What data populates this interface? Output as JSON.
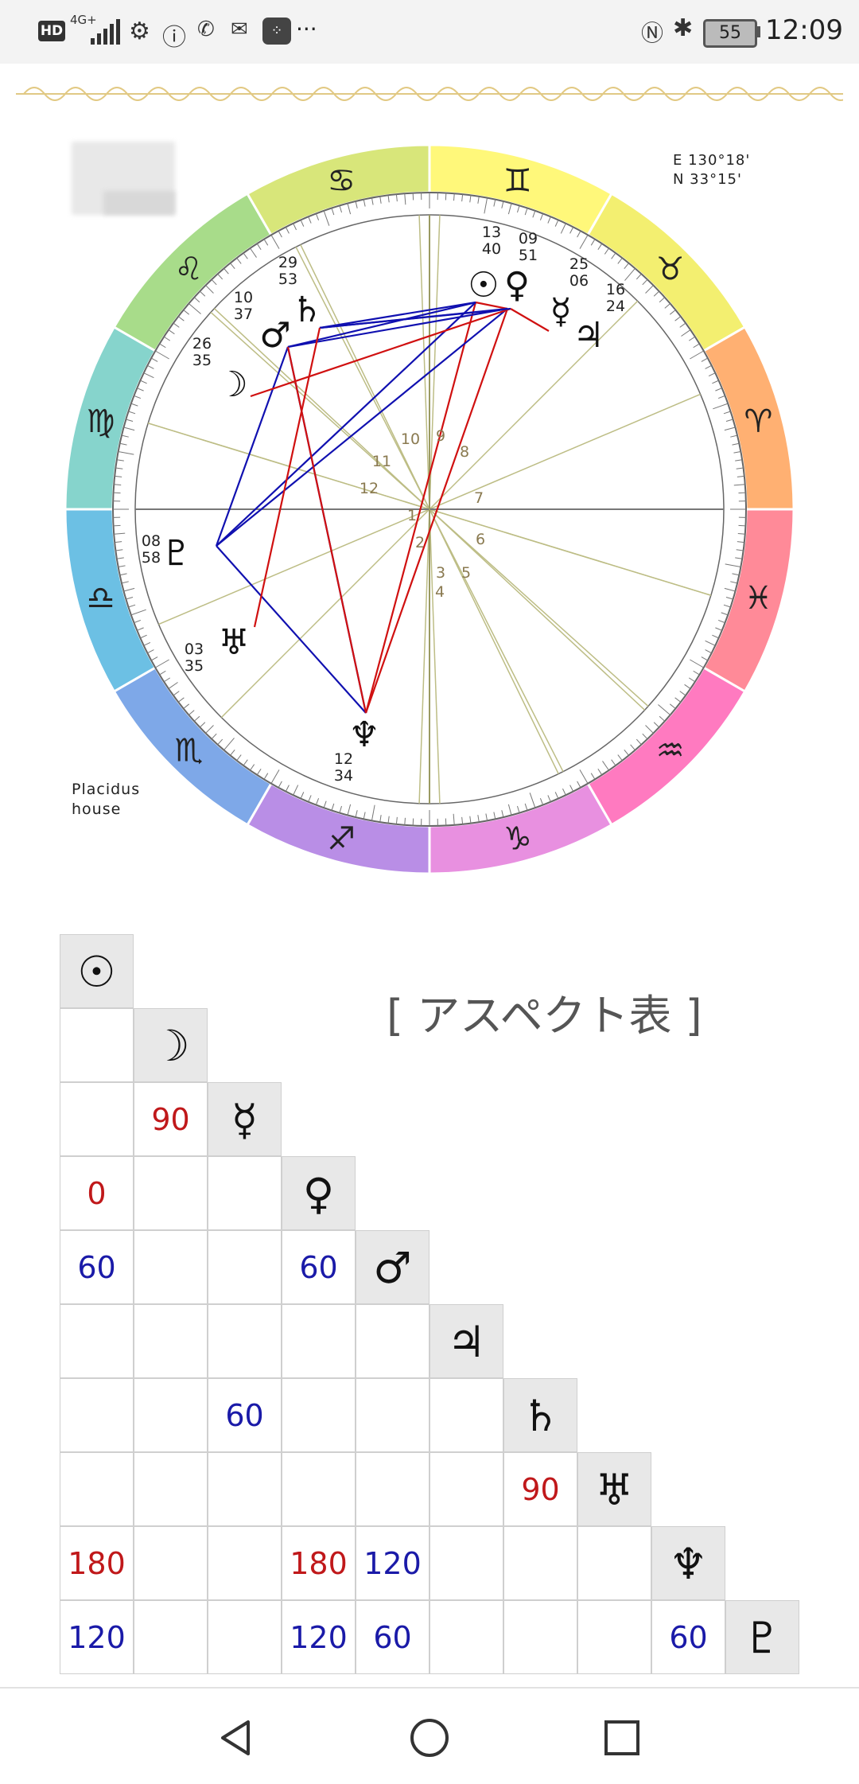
{
  "status_bar": {
    "hd": "HD",
    "network": "4G+",
    "battery": "55",
    "time": "12:09",
    "more": "···"
  },
  "chart": {
    "coords": [
      "E 130°18'",
      "N 33°15'"
    ],
    "house_system": [
      "Placidus",
      "house"
    ],
    "house_numbers": [
      "1",
      "2",
      "3",
      "4",
      "5",
      "6",
      "7",
      "8",
      "9",
      "10",
      "11",
      "12"
    ],
    "degree_labels": [
      [
        "13",
        "40"
      ],
      [
        "09",
        "51"
      ],
      [
        "25",
        "06"
      ],
      [
        "16",
        "24"
      ],
      [
        "29",
        "53"
      ],
      [
        "10",
        "37"
      ],
      [
        "26",
        "35"
      ],
      [
        "08",
        "58"
      ],
      [
        "03",
        "35"
      ],
      [
        "12",
        "34"
      ]
    ],
    "planets": [
      "☉",
      "♀",
      "☿",
      "♃",
      "♄",
      "♂",
      "☽",
      "♇",
      "♅",
      "♆"
    ],
    "signs": [
      "♊",
      "♉",
      "♈",
      "♓",
      "♒",
      "♑",
      "♐",
      "♏",
      "♎",
      "♍",
      "♌",
      "♋"
    ],
    "colors": {
      "red_aspect": "#d01010",
      "blue_aspect": "#1010b0",
      "house_line": "#bdbd85",
      "axis_line": "#777777"
    }
  },
  "aspect_table": {
    "title": "[ アスペクト表 ]",
    "planets": [
      "☉",
      "☽",
      "☿",
      "♀",
      "♂",
      "♃",
      "♄",
      "♅",
      "♆",
      "♇"
    ],
    "rows": [
      [],
      [
        ""
      ],
      [
        "",
        "90"
      ],
      [
        "0",
        "",
        ""
      ],
      [
        "60",
        "",
        "",
        "60"
      ],
      [
        "",
        "",
        "",
        "",
        ""
      ],
      [
        "",
        "",
        "60",
        "",
        "",
        ""
      ],
      [
        "",
        "",
        "",
        "",
        "",
        "",
        "90"
      ],
      [
        "180",
        "",
        "",
        "180",
        "120",
        "",
        "",
        ""
      ],
      [
        "120",
        "",
        "",
        "120",
        "60",
        "",
        "",
        "",
        "60"
      ]
    ],
    "colors": {
      "0": "#c0181a",
      "90": "#c0181a",
      "180": "#c0181a",
      "60": "#1a1aa8",
      "120": "#1a1aa8"
    }
  }
}
